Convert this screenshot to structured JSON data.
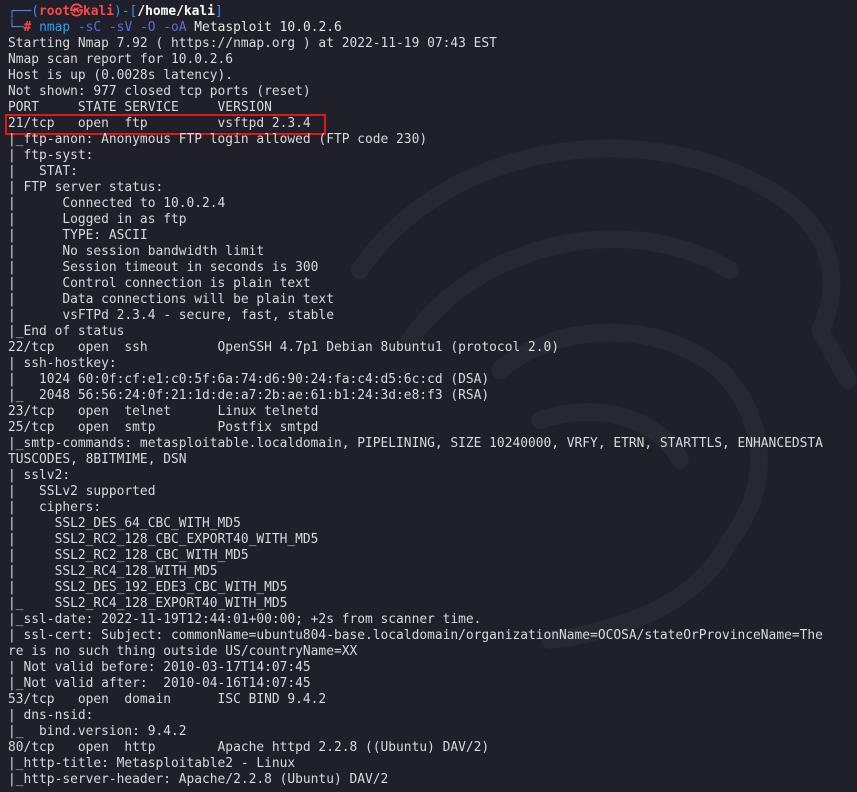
{
  "prompt": {
    "corner_top": "┌──(",
    "user": "root㉿kali",
    "sep_open": ")-[",
    "path": "/home/kali",
    "sep_close": "]",
    "corner_bottom": "└─",
    "hash": "#",
    "cmd_name": "nmap",
    "cmd_flags": "-sC -sV -O -oA",
    "cmd_rest": "Metasploit 10.0.2.6"
  },
  "colors": {
    "background": "#1f2029",
    "text": "#d9d9d9",
    "highlight_border": "#e0171b",
    "prompt_accent": "#3b8eea",
    "prompt_user": "#ff4747"
  },
  "output_lines": [
    "Starting Nmap 7.92 ( https://nmap.org ) at 2022-11-19 07:43 EST",
    "Nmap scan report for 10.0.2.6",
    "Host is up (0.0028s latency).",
    "Not shown: 977 closed tcp ports (reset)",
    "PORT     STATE SERVICE     VERSION",
    "21/tcp   open  ftp         vsftpd 2.3.4",
    "|_ftp-anon: Anonymous FTP login allowed (FTP code 230)",
    "| ftp-syst:",
    "|   STAT:",
    "| FTP server status:",
    "|      Connected to 10.0.2.4",
    "|      Logged in as ftp",
    "|      TYPE: ASCII",
    "|      No session bandwidth limit",
    "|      Session timeout in seconds is 300",
    "|      Control connection is plain text",
    "|      Data connections will be plain text",
    "|      vsFTPd 2.3.4 - secure, fast, stable",
    "|_End of status",
    "22/tcp   open  ssh         OpenSSH 4.7p1 Debian 8ubuntu1 (protocol 2.0)",
    "| ssh-hostkey:",
    "|   1024 60:0f:cf:e1:c0:5f:6a:74:d6:90:24:fa:c4:d5:6c:cd (DSA)",
    "|_  2048 56:56:24:0f:21:1d:de:a7:2b:ae:61:b1:24:3d:e8:f3 (RSA)",
    "23/tcp   open  telnet      Linux telnetd",
    "25/tcp   open  smtp        Postfix smtpd",
    "|_smtp-commands: metasploitable.localdomain, PIPELINING, SIZE 10240000, VRFY, ETRN, STARTTLS, ENHANCEDSTA",
    "TUSCODES, 8BITMIME, DSN",
    "| sslv2:",
    "|   SSLv2 supported",
    "|   ciphers:",
    "|     SSL2_DES_64_CBC_WITH_MD5",
    "|     SSL2_RC2_128_CBC_EXPORT40_WITH_MD5",
    "|     SSL2_RC2_128_CBC_WITH_MD5",
    "|     SSL2_RC4_128_WITH_MD5",
    "|     SSL2_DES_192_EDE3_CBC_WITH_MD5",
    "|_    SSL2_RC4_128_EXPORT40_WITH_MD5",
    "|_ssl-date: 2022-11-19T12:44:01+00:00; +2s from scanner time.",
    "| ssl-cert: Subject: commonName=ubuntu804-base.localdomain/organizationName=OCOSA/stateOrProvinceName=The",
    "re is no such thing outside US/countryName=XX",
    "| Not valid before: 2010-03-17T14:07:45",
    "|_Not valid after:  2010-04-16T14:07:45",
    "53/tcp   open  domain      ISC BIND 9.4.2",
    "| dns-nsid:",
    "|_  bind.version: 9.4.2",
    "80/tcp   open  http        Apache httpd 2.2.8 ((Ubuntu) DAV/2)",
    "|_http-title: Metasploitable2 - Linux",
    "|_http-server-header: Apache/2.2.8 (Ubuntu) DAV/2"
  ]
}
